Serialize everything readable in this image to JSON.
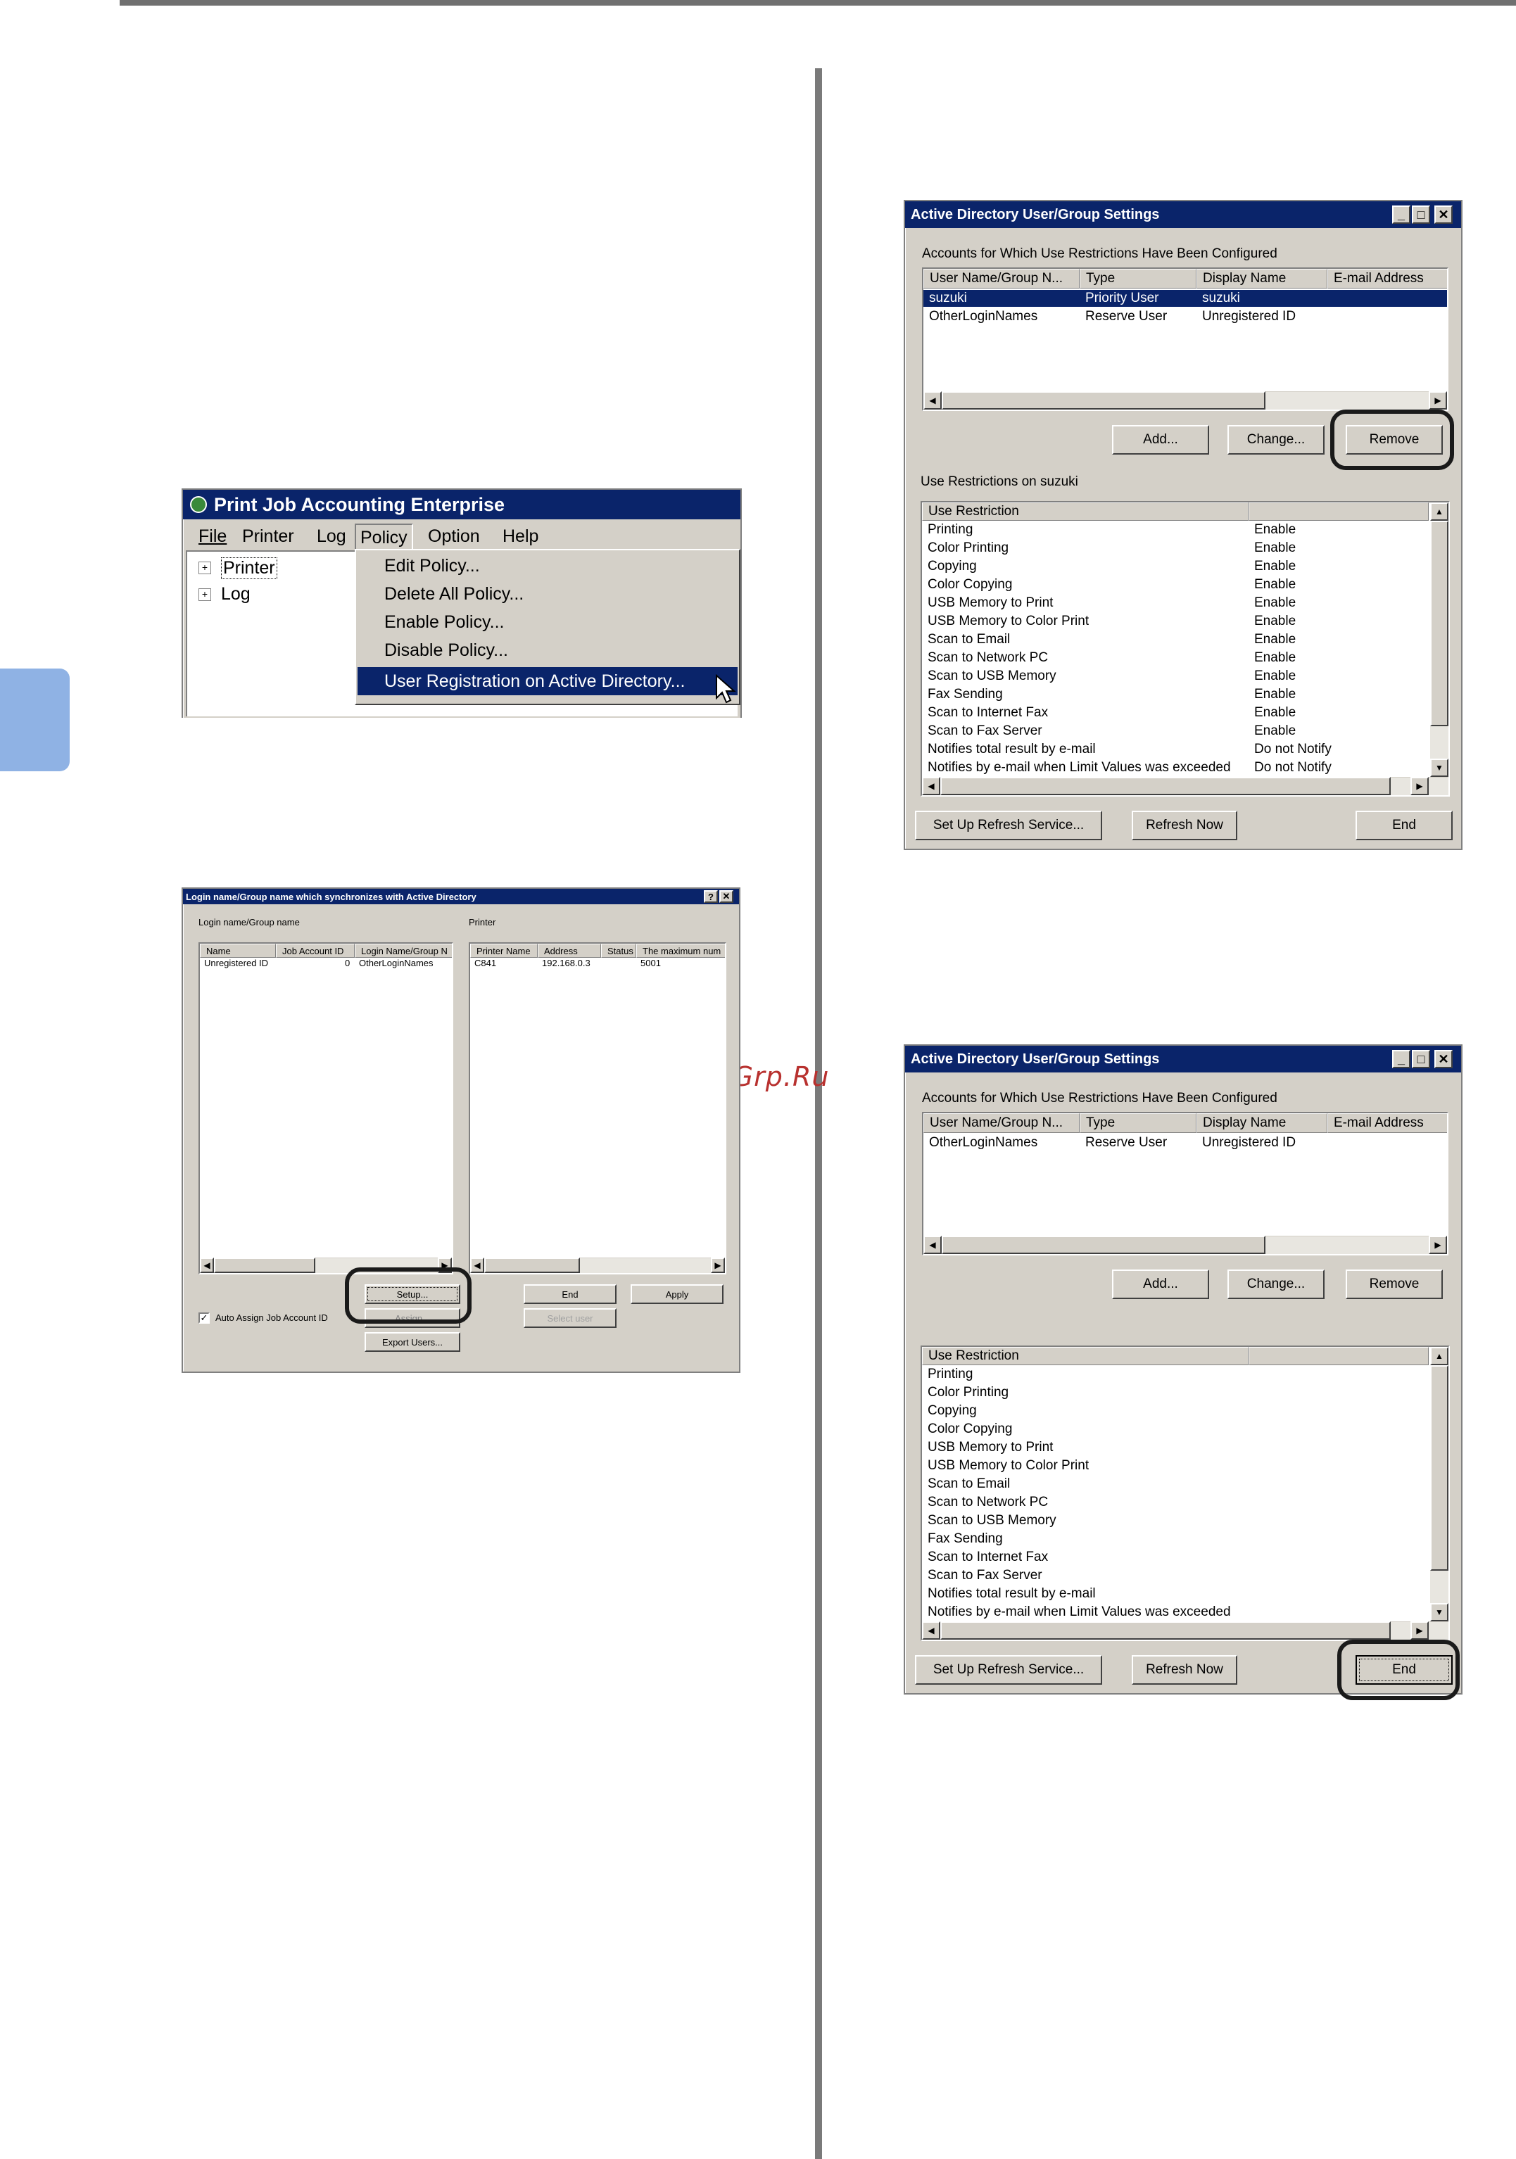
{
  "watermark": "McGrp.Ru",
  "pjae": {
    "title": "Print Job Accounting Enterprise",
    "menu": [
      "File",
      "Printer",
      "Log",
      "Policy",
      "Option",
      "Help"
    ],
    "tree": [
      "Printer",
      "Log"
    ],
    "dropdown": [
      "Edit Policy...",
      "Delete All Policy...",
      "Enable Policy...",
      "Disable Policy...",
      "User Registration on Active Directory..."
    ]
  },
  "sync_dialog": {
    "title": "Login name/Group name which synchronizes with Active Directory",
    "left_label": "Login name/Group name",
    "right_label": "Printer",
    "left_headers": [
      "Name",
      "Job Account ID",
      "Login Name/Group N"
    ],
    "left_row": [
      "Unregistered ID",
      "0",
      "OtherLoginNames"
    ],
    "right_headers": [
      "Printer Name",
      "Address",
      "Status",
      "The maximum num"
    ],
    "right_row": [
      "C841",
      "192.168.0.3",
      "",
      "5001"
    ],
    "checkbox": "Auto Assign Job Account ID",
    "buttons": {
      "setup": "Setup...",
      "assign": "Assign...",
      "export": "Export Users...",
      "end": "End",
      "apply": "Apply",
      "select_user": "Select user"
    }
  },
  "ad1": {
    "title": "Active Directory User/Group Settings",
    "accounts_label": "Accounts for Which Use Restrictions Have Been Configured",
    "headers": [
      "User Name/Group N...",
      "Type",
      "Display Name",
      "E-mail Address"
    ],
    "rows": [
      [
        "suzuki",
        "Priority User",
        "suzuki"
      ],
      [
        "OtherLoginNames",
        "Reserve User",
        "Unregistered ID"
      ]
    ],
    "buttons": {
      "add": "Add...",
      "change": "Change...",
      "remove": "Remove"
    },
    "restrictions_label": "Use Restrictions on suzuki",
    "restriction_header": "Use Restriction",
    "restrictions": [
      [
        "Printing",
        "Enable"
      ],
      [
        "Color Printing",
        "Enable"
      ],
      [
        "Copying",
        "Enable"
      ],
      [
        "Color Copying",
        "Enable"
      ],
      [
        "USB Memory to Print",
        "Enable"
      ],
      [
        "USB Memory to Color Print",
        "Enable"
      ],
      [
        "Scan to Email",
        "Enable"
      ],
      [
        "Scan to Network PC",
        "Enable"
      ],
      [
        "Scan to USB Memory",
        "Enable"
      ],
      [
        "Fax Sending",
        "Enable"
      ],
      [
        "Scan to Internet Fax",
        "Enable"
      ],
      [
        "Scan to Fax Server",
        "Enable"
      ],
      [
        "Notifies total result by e-mail",
        "Do not Notify"
      ],
      [
        "Notifies by e-mail when Limit Values was exceeded",
        "Do not Notify"
      ]
    ],
    "bottom_buttons": {
      "refresh_service": "Set Up Refresh Service...",
      "refresh_now": "Refresh Now",
      "end": "End"
    }
  },
  "ad2": {
    "title": "Active Directory User/Group Settings",
    "accounts_label": "Accounts for Which Use Restrictions Have Been Configured",
    "headers": [
      "User Name/Group N...",
      "Type",
      "Display Name",
      "E-mail Address"
    ],
    "rows": [
      [
        "OtherLoginNames",
        "Reserve User",
        "Unregistered ID"
      ]
    ],
    "buttons": {
      "add": "Add...",
      "change": "Change...",
      "remove": "Remove"
    },
    "restriction_header": "Use Restriction",
    "restrictions": [
      "Printing",
      "Color Printing",
      "Copying",
      "Color Copying",
      "USB Memory to Print",
      "USB Memory to Color Print",
      "Scan to Email",
      "Scan to Network PC",
      "Scan to USB Memory",
      "Fax Sending",
      "Scan to Internet Fax",
      "Scan to Fax Server",
      "Notifies total result by e-mail",
      "Notifies by e-mail when Limit Values was exceeded"
    ],
    "bottom_buttons": {
      "refresh_service": "Set Up Refresh Service...",
      "refresh_now": "Refresh Now",
      "end": "End"
    }
  }
}
